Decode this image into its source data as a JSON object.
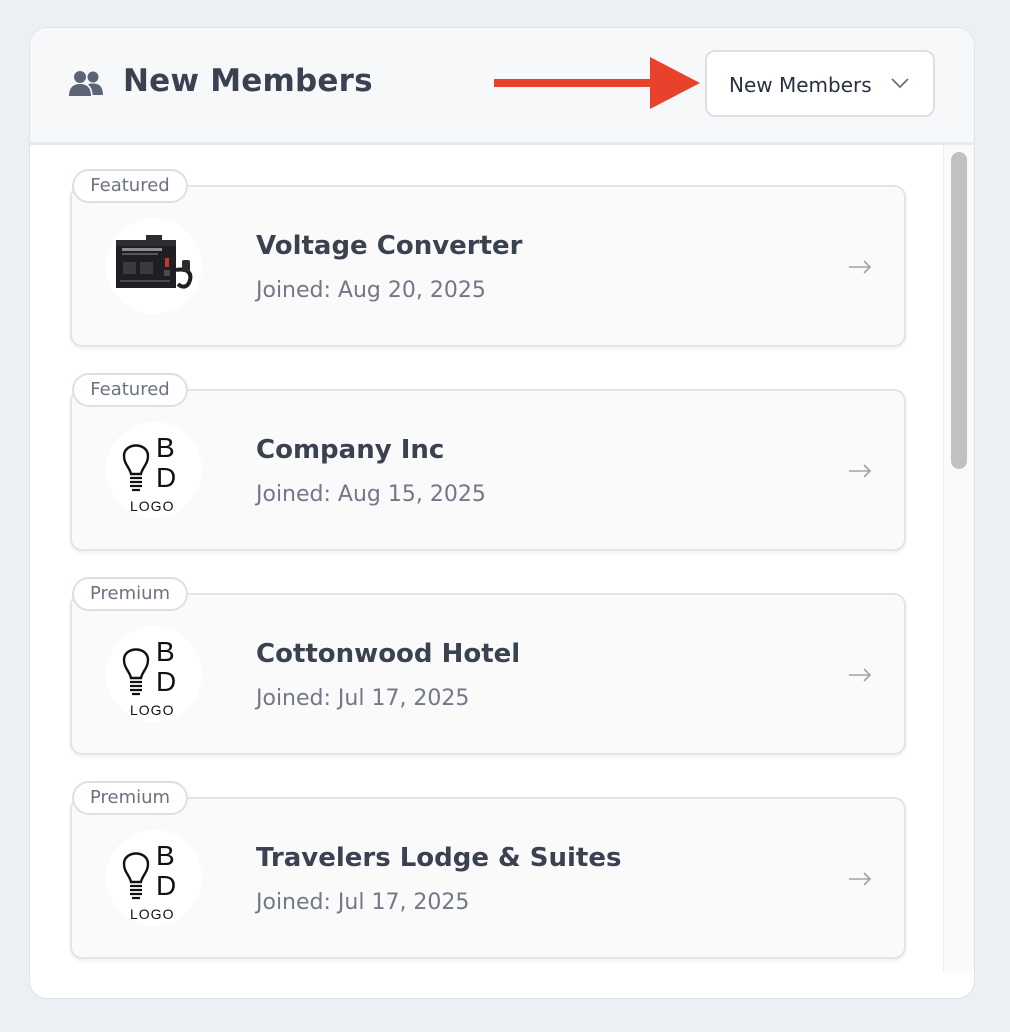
{
  "header": {
    "title": "New Members",
    "icon": "users-icon",
    "dropdown": {
      "selected": "New Members"
    }
  },
  "members": [
    {
      "badge": "Featured",
      "name": "Voltage Converter",
      "joined": "Joined: Aug 20, 2025",
      "avatar": "voltage-converter-image"
    },
    {
      "badge": "Featured",
      "name": "Company Inc",
      "joined": "Joined: Aug 15, 2025",
      "avatar": "bd-logo"
    },
    {
      "badge": "Premium",
      "name": "Cottonwood Hotel",
      "joined": "Joined: Jul 17, 2025",
      "avatar": "bd-logo"
    },
    {
      "badge": "Premium",
      "name": "Travelers Lodge & Suites",
      "joined": "Joined: Jul 17, 2025",
      "avatar": "bd-logo"
    }
  ],
  "logo_text": {
    "b": "B",
    "d": "D",
    "caption": "LOGO"
  },
  "colors": {
    "annotation_arrow": "#e8412c",
    "title": "#3a4150",
    "muted": "#727887"
  }
}
